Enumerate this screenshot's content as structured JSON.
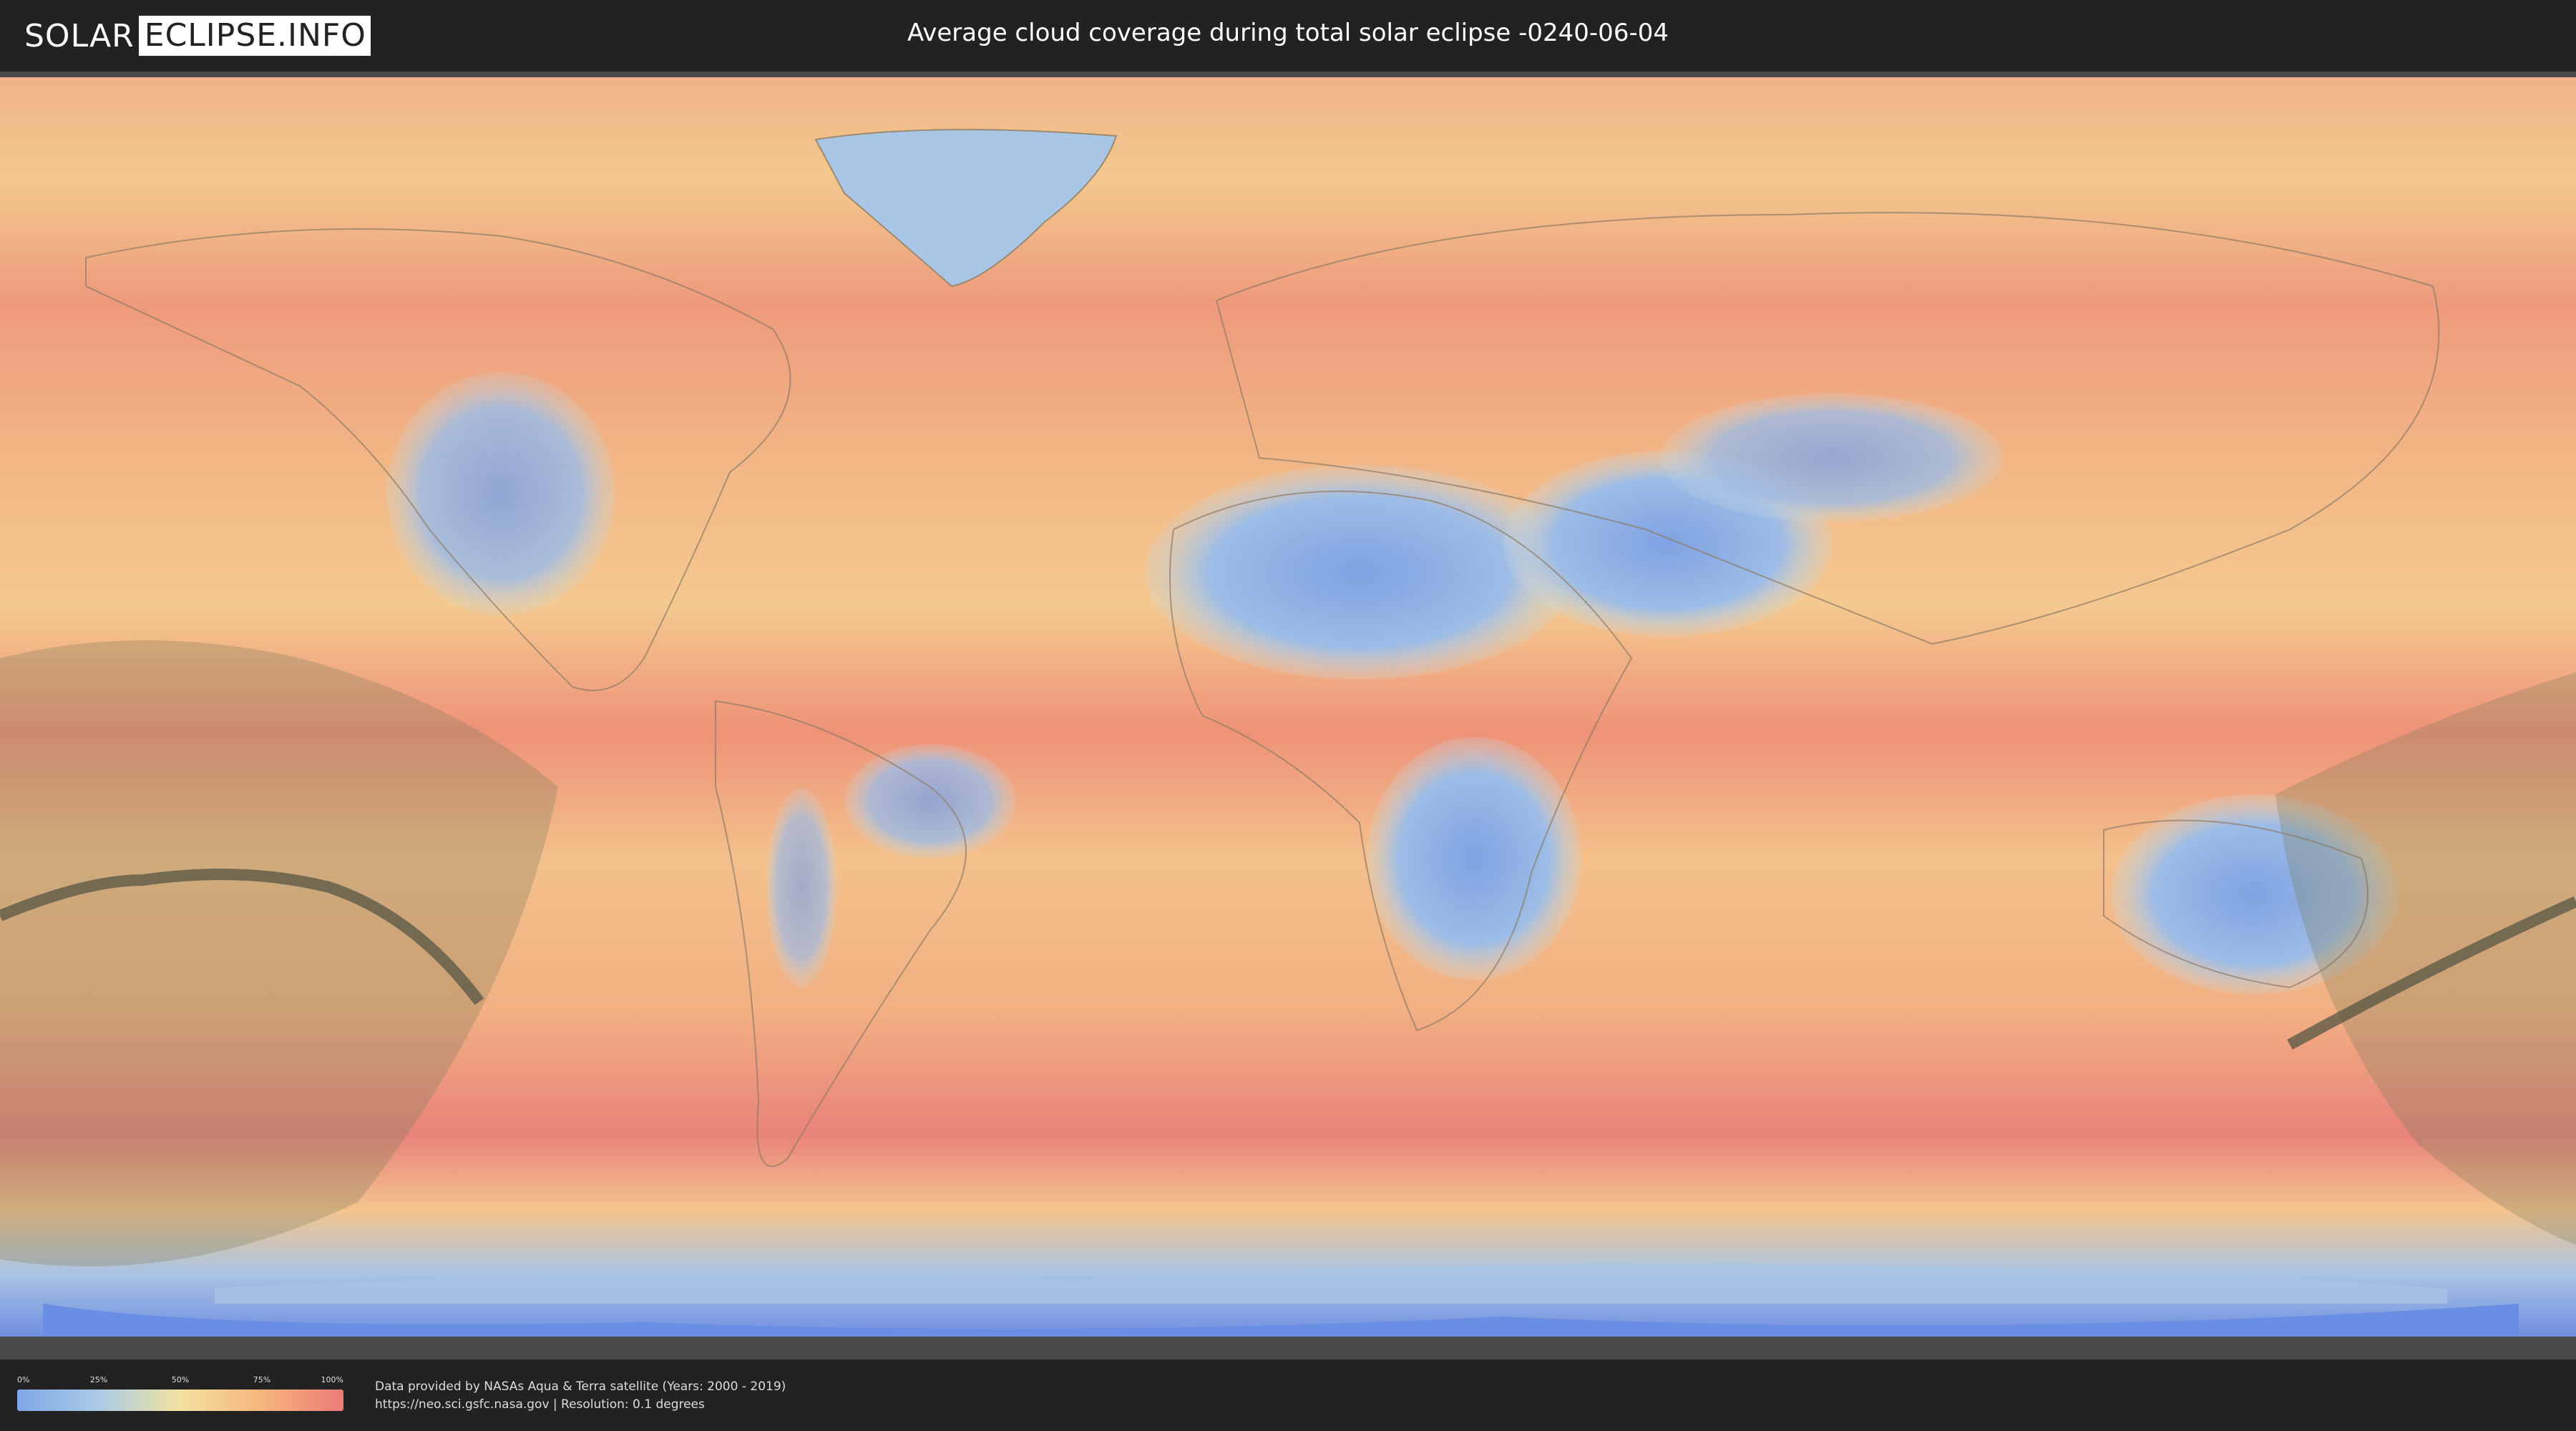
{
  "header": {
    "logo_left": "SOLAR",
    "logo_right": "ECLIPSE.INFO",
    "title": "Average cloud coverage during total solar eclipse -0240-06-04"
  },
  "map": {
    "icon": "world-map-cloud-coverage",
    "eclipse_shadow_color": "#7a7a5a",
    "eclipse_path_color": "#555544"
  },
  "legend": {
    "ticks": [
      "0%",
      "25%",
      "50%",
      "75%",
      "100%"
    ],
    "colors": [
      "#7fa6e6",
      "#a9cbe6",
      "#f3e2a0",
      "#f5b57c",
      "#ec7b78"
    ]
  },
  "credits": {
    "line1": "Data provided by NASAs Aqua & Terra satellite (Years: 2000 - 2019)",
    "line2": "https://neo.sci.gsfc.nasa.gov | Resolution: 0.1 degrees"
  }
}
